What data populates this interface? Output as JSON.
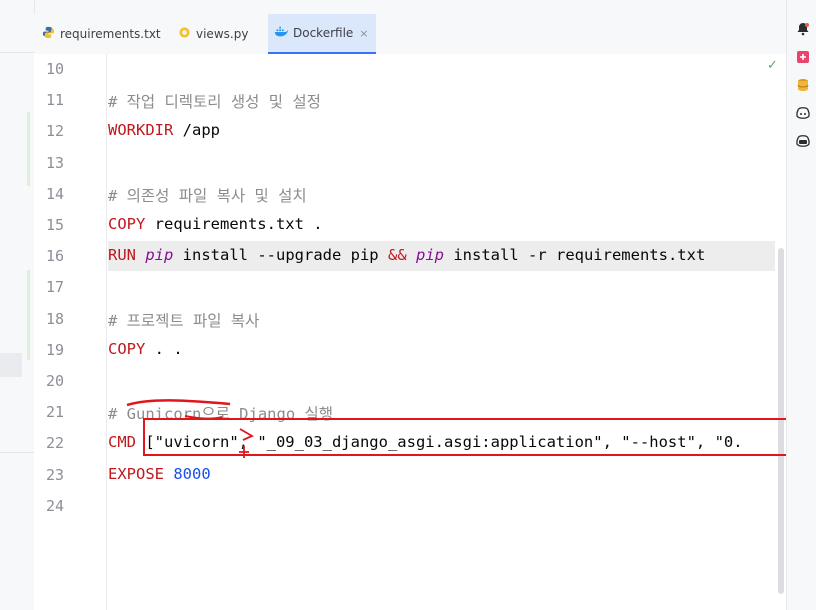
{
  "tabs": [
    {
      "label": "requirements.txt",
      "icon": "python-icon"
    },
    {
      "label": "views.py",
      "icon": "python-file-icon"
    },
    {
      "label": "Dockerfile",
      "icon": "docker-icon",
      "active": true,
      "close": "×"
    }
  ],
  "kebab": "⋮",
  "lines": {
    "l10": {
      "num": "10"
    },
    "l11": {
      "num": "11",
      "comment": "# 작업 디렉토리 생성 및 설정"
    },
    "l12": {
      "num": "12",
      "kw": "WORKDIR",
      "rest": " /app"
    },
    "l13": {
      "num": "13"
    },
    "l14": {
      "num": "14",
      "comment": "# 의존성 파일 복사 및 설치"
    },
    "l15": {
      "num": "15",
      "kw": "COPY",
      "rest": " requirements.txt ."
    },
    "l16": {
      "num": "16",
      "kw": "RUN",
      "pip1": "pip",
      "mid": " install --upgrade pip ",
      "amp": "&&",
      "pip2": "pip",
      "tail": " install -r requirements.txt"
    },
    "l17": {
      "num": "17"
    },
    "l18": {
      "num": "18",
      "comment": "# 프로젝트 파일 복사"
    },
    "l19": {
      "num": "19",
      "kw": "COPY",
      "rest": " . ."
    },
    "l20": {
      "num": "20"
    },
    "l21": {
      "num": "21",
      "comment": "# Gunicorn으로 Django 실행"
    },
    "l22": {
      "num": "22",
      "kw": "CMD",
      "rest": " [\"uvicorn\", \"_09_03_django_asgi.asgi:application\", \"--host\", \"0."
    },
    "l23": {
      "num": "23",
      "kw": "EXPOSE",
      "rest": " 8000"
    },
    "l24": {
      "num": "24"
    }
  },
  "colors": {
    "keyword": "#c0181c",
    "comment": "#8c8c8c",
    "annotation": "#e0161c",
    "accent": "#3574f0"
  },
  "right_toolbar": [
    "notifications-icon",
    "ai-assistant-icon",
    "database-icon",
    "copilot-icon",
    "copilot-chat-icon"
  ]
}
